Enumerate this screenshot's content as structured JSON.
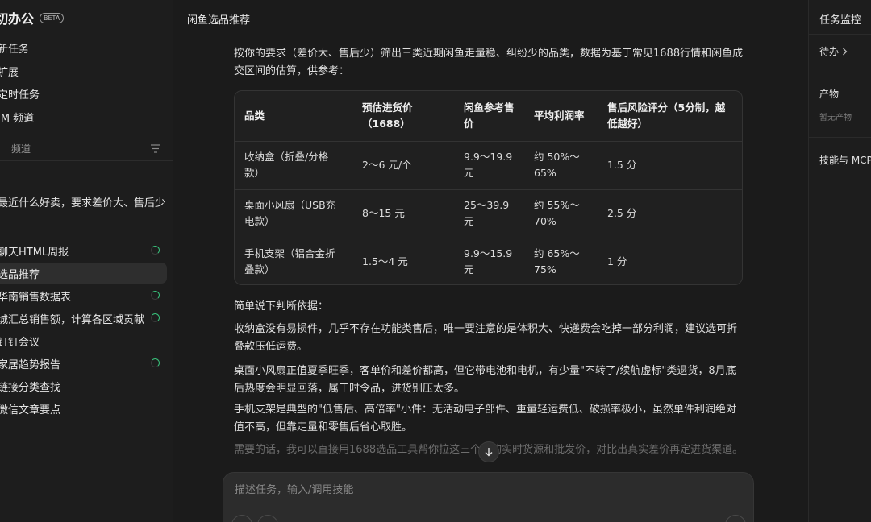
{
  "sidebar": {
    "brand": "切办公",
    "beta": "BETA",
    "nav": [
      "新任务",
      "扩展",
      "定时任务",
      "IM 频道"
    ],
    "channel_label": "频道",
    "recent_message": "最近什么好卖，要求差价大、售后少",
    "tasks": [
      {
        "label": "聊天HTML周报",
        "loading": true
      },
      {
        "label": "选品推荐",
        "loading": false,
        "active": true
      },
      {
        "label": "华南销售数据表",
        "loading": true
      },
      {
        "label": "城汇总销售额，计算各区域贡献占比",
        "loading": true
      },
      {
        "label": "钉钉会议",
        "loading": false
      },
      {
        "label": "家居趋势报告",
        "loading": true
      },
      {
        "label": "链接分类查找",
        "loading": false
      },
      {
        "label": "微信文章要点",
        "loading": false
      }
    ]
  },
  "main": {
    "title": "闲鱼选品推荐",
    "intro": "按你的要求（差价大、售后少）筛出三类近期闲鱼走量稳、纠纷少的品类，数据为基于常见1688行情和闲鱼成交区间的估算，供参考：",
    "table": {
      "headers": [
        "品类",
        "预估进货价（1688）",
        "闲鱼参考售价",
        "平均利润率",
        "售后风险评分（5分制，越低越好）"
      ],
      "rows": [
        [
          "收纳盒（折叠/分格款）",
          "2～6 元/个",
          "9.9～19.9 元",
          "约 50%～65%",
          "1.5 分"
        ],
        [
          "桌面小风扇（USB充电款）",
          "8～15 元",
          "25～39.9 元",
          "约 55%～70%",
          "2.5 分"
        ],
        [
          "手机支架（铝合金折叠款）",
          "1.5～4 元",
          "9.9～15.9 元",
          "约 65%～75%",
          "1 分"
        ]
      ]
    },
    "basis_title": "简单说下判断依据：",
    "paragraphs": [
      "收纳盒没有易损件，几乎不存在功能类售后，唯一要注意的是体积大、快递费会吃掉一部分利润，建议选可折叠款压低运费。",
      "桌面小风扇正值夏季旺季，客单价和差价都高，但它带电池和电机，有少量\"不转了/续航虚标\"类退货，8月底后热度会明显回落，属于时令品，进货别压太多。",
      "手机支架是典型的\"低售后、高倍率\"小件：无活动电子部件、重量轻运费低、破损率极小，虽然单件利润绝对值不高，但靠走量和零售后省心取胜。",
      "需要的话，我可以直接用1688选品工具帮你拉这三个品的实时货源和批发价，对比出真实差价再定进货渠道。"
    ],
    "composer_placeholder": "描述任务，输入/调用技能"
  },
  "right": {
    "title": "任务监控",
    "todo": "待办",
    "outputs": "产物",
    "no_outputs": "暂无产物",
    "skills": "技能与 MCP"
  },
  "colors": {
    "background": "#1b1b1b",
    "panel": "#1d1d1d",
    "spinner_accent": "#38c07a",
    "composer": "#2c2c2c"
  }
}
